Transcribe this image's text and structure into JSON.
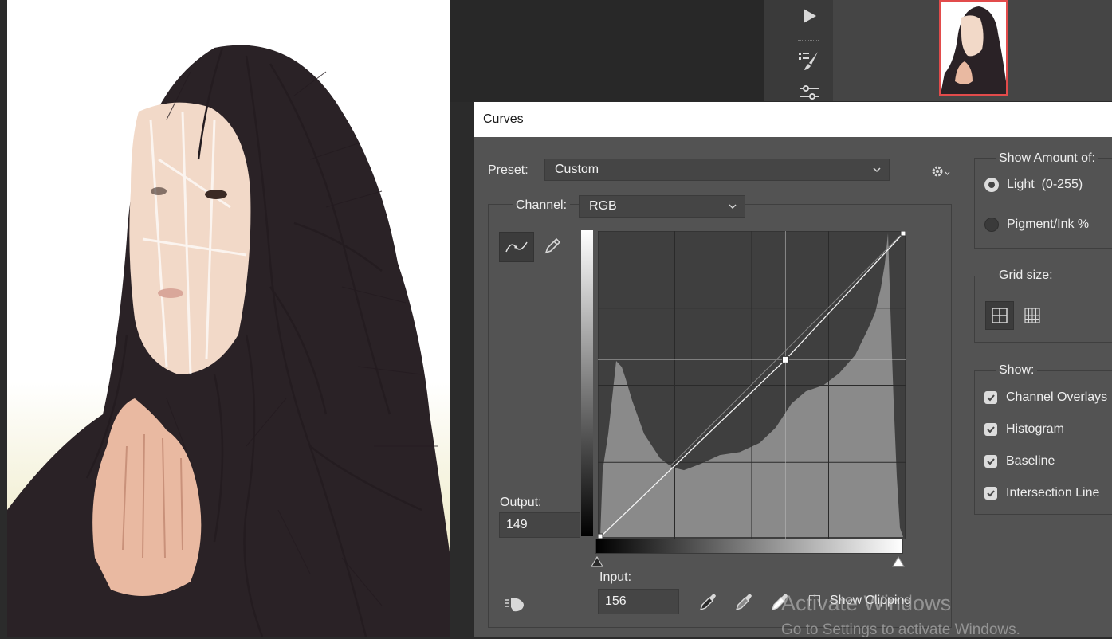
{
  "dialog": {
    "title": "Curves",
    "preset_label": "Preset:",
    "preset_value": "Custom",
    "channel_label": "Channel:",
    "channel_value": "RGB",
    "output_label": "Output:",
    "output_value": "149",
    "input_label": "Input:",
    "input_value": "156",
    "show_clipping_label": "Show Clipping"
  },
  "show_amount": {
    "title": "Show Amount of:",
    "options": [
      {
        "label": "Light  (0-255)",
        "selected": true
      },
      {
        "label": "Pigment/Ink %",
        "selected": false
      }
    ]
  },
  "grid_size": {
    "title": "Grid size:"
  },
  "show": {
    "title": "Show:",
    "items": [
      {
        "label": "Channel Overlays",
        "checked": true
      },
      {
        "label": "Histogram",
        "checked": true
      },
      {
        "label": "Baseline",
        "checked": true
      },
      {
        "label": "Intersection Line",
        "checked": true
      }
    ]
  },
  "curve": {
    "control_point": {
      "input": 156,
      "output": 149
    }
  },
  "watermark": {
    "line1": "Activate Windows",
    "line2": "Go to Settings to activate Windows."
  },
  "colors": {
    "dialog_bg": "#535353",
    "graph_bg": "#3f3f3f",
    "histogram": "#8a8a8a",
    "layer_selected_border": "#e24b4b"
  },
  "icons": [
    "play-icon",
    "brush-settings-icon",
    "adjustments-icon",
    "curve-point-icon",
    "pencil-icon",
    "gear-icon",
    "grid-4-icon",
    "grid-10-icon",
    "on-image-adjust-icon",
    "black-point-eyedropper-icon",
    "gray-point-eyedropper-icon",
    "white-point-eyedropper-icon"
  ]
}
